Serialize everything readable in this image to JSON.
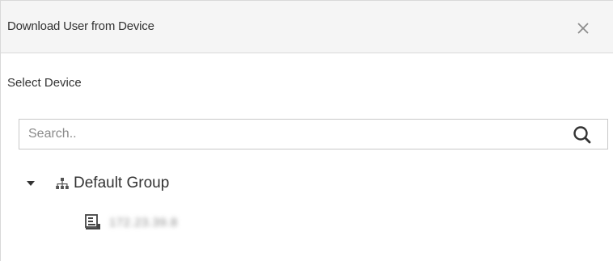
{
  "dialog": {
    "title": "Download User from Device",
    "close_icon": "close-icon"
  },
  "section": {
    "label": "Select Device"
  },
  "search": {
    "placeholder": "Search..",
    "value": "",
    "icon": "search-icon"
  },
  "tree": {
    "group": {
      "label": "Default Group",
      "expanded": true,
      "icon": "org-tree-icon"
    },
    "devices": [
      {
        "name": "172.23.39.8",
        "icon": "device-icon"
      }
    ]
  }
}
